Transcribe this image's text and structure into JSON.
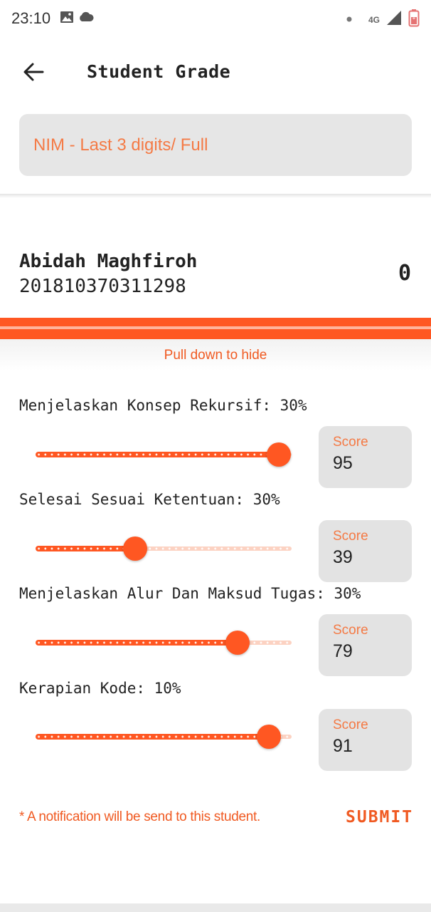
{
  "status_bar": {
    "time": "23:10",
    "network": "4G"
  },
  "app_bar": {
    "title": "Student Grade"
  },
  "search": {
    "placeholder": "NIM - Last 3 digits/ Full",
    "value": ""
  },
  "student": {
    "name": "Abidah Maghfiroh",
    "nim": "201810370311298",
    "total": "0"
  },
  "panel": {
    "hint": "Pull down to hide"
  },
  "criteria": [
    {
      "label": "Menjelaskan Konsep Rekursif: 30%",
      "score_label": "Score",
      "score": "95",
      "level": 0.95
    },
    {
      "label": "Selesai Sesuai Ketentuan: 30%",
      "score_label": "Score",
      "score": "39",
      "level": 0.39
    },
    {
      "label": "Menjelaskan Alur Dan Maksud Tugas: 30%",
      "score_label": "Score",
      "score": "79",
      "level": 0.79
    },
    {
      "label": "Kerapian Kode: 10%",
      "score_label": "Score",
      "score": "91",
      "level": 0.91
    }
  ],
  "footer": {
    "notice": "* A notification will be send to this student.",
    "submit_label": "SUBMIT"
  },
  "colors": {
    "accent": "#ff5722",
    "accent_light": "#fcd2c2",
    "placeholder": "#f47a45",
    "field_bg": "#e6e6e6"
  }
}
